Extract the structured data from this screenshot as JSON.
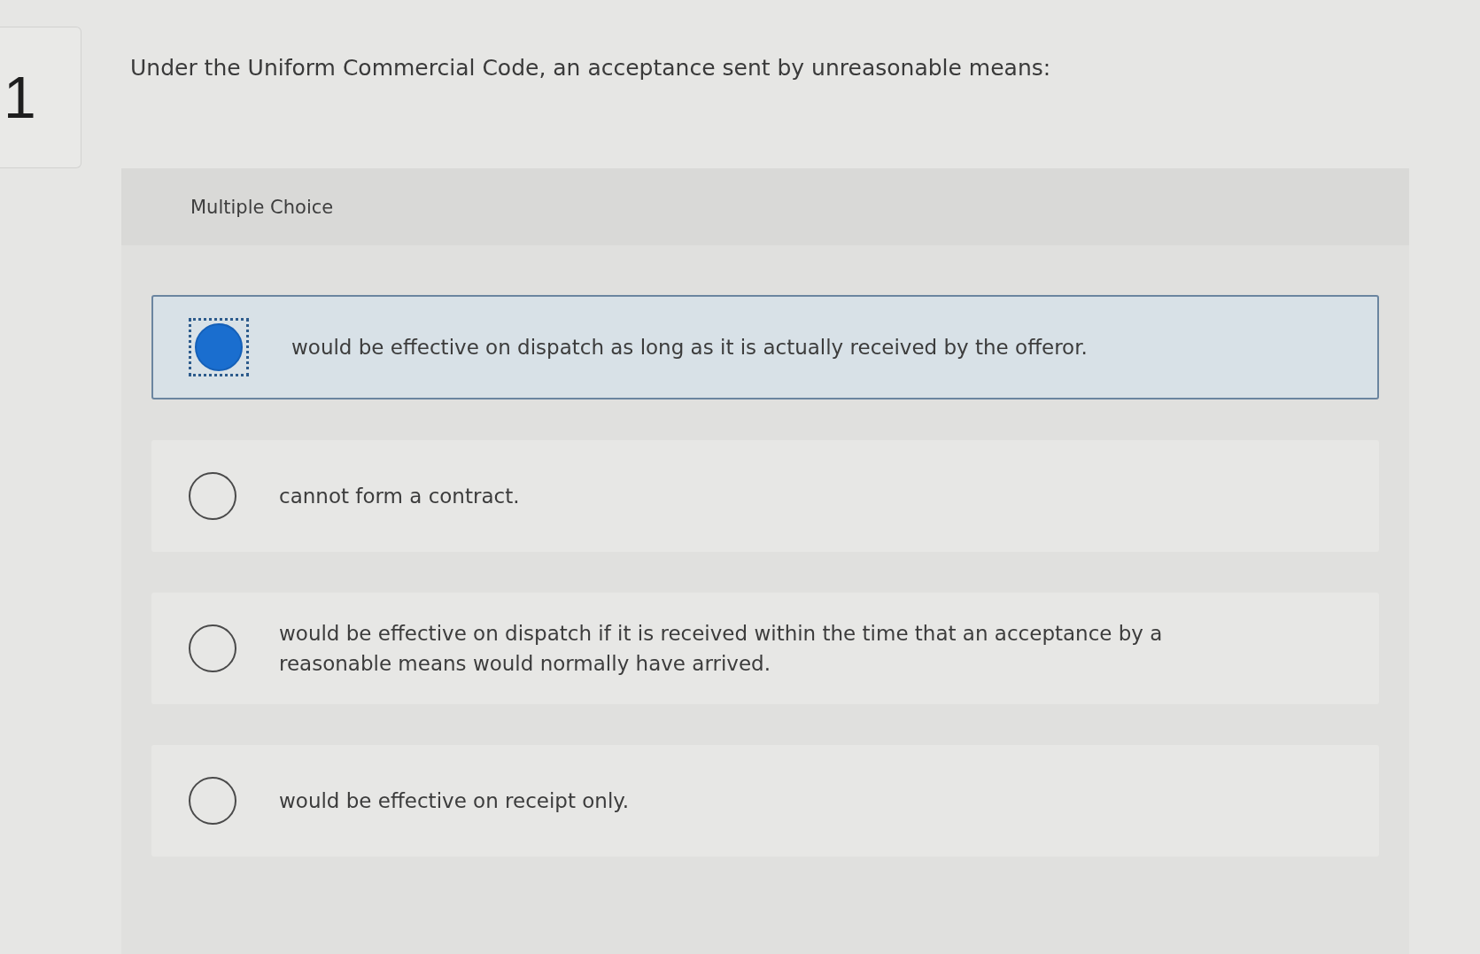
{
  "question": {
    "number": "1",
    "text": "Under the Uniform Commercial Code, an acceptance sent by unreasonable means:"
  },
  "panel": {
    "type_label": "Multiple Choice"
  },
  "options": [
    {
      "text": "would be effective on dispatch as long as it is actually received by the offeror.",
      "selected": true,
      "focused": true
    },
    {
      "text": "cannot form a contract.",
      "selected": false,
      "focused": false
    },
    {
      "text": "would be effective on dispatch if it is received within the time that an acceptance by a reasonable means would normally have arrived.",
      "selected": false,
      "focused": false
    },
    {
      "text": "would be effective on receipt only.",
      "selected": false,
      "focused": false
    }
  ]
}
